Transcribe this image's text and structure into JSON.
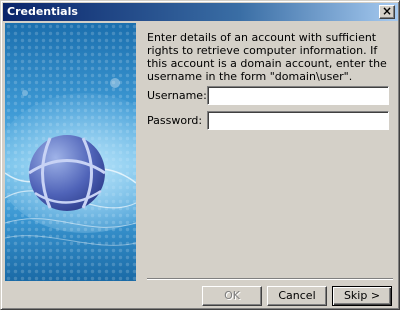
{
  "window": {
    "title": "Credentials",
    "close_glyph": "×"
  },
  "intro_text": "Enter details of an account with sufficient rights to retrieve computer information. If this account is a domain account, enter the username in the form \"domain\\user\".",
  "username": {
    "label": "Username:",
    "value": ""
  },
  "password": {
    "label": "Password:",
    "value": ""
  },
  "buttons": {
    "ok": "OK",
    "cancel": "Cancel",
    "skip": "Skip >"
  },
  "colors": {
    "titlebar_start": "#0a246a",
    "titlebar_end": "#a6caf0",
    "banner_blue": "#3f9bd6",
    "dialog_face": "#d4d0c8"
  },
  "icons": {
    "banner_graphic": "basketball-globe-icon"
  }
}
